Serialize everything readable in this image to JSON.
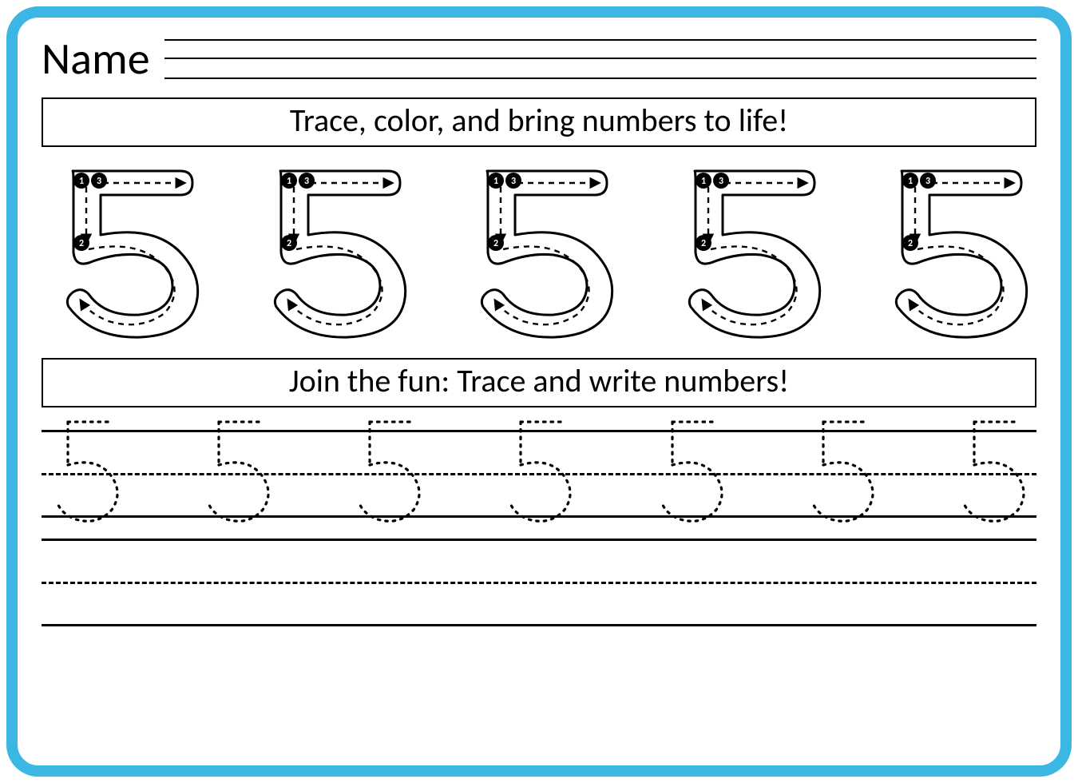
{
  "name_label": "Name",
  "instruction_top": "Trace, color, and bring numbers to life!",
  "instruction_mid": "Join the fun: Trace and write numbers!",
  "number": "5",
  "stroke_labels": {
    "s1": "1",
    "s2": "2",
    "s3": "3"
  },
  "big_count": 5,
  "dotted_count": 7,
  "colors": {
    "frame": "#3cb6e3",
    "ink": "#000000"
  }
}
